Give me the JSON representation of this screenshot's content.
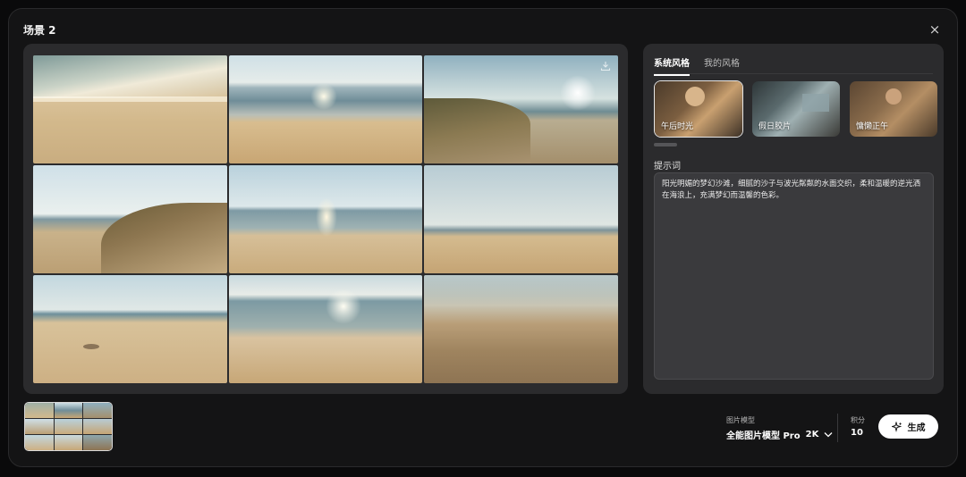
{
  "modal": {
    "title": "场景 2",
    "close_icon": "×"
  },
  "style_tabs": [
    {
      "label": "系统风格",
      "active": true
    },
    {
      "label": "我的风格",
      "active": false
    }
  ],
  "styles": [
    {
      "label": "午后时光",
      "selected": true
    },
    {
      "label": "假日胶片",
      "selected": false
    },
    {
      "label": "慵懒正午",
      "selected": false
    }
  ],
  "prompt": {
    "label": "提示词",
    "value": "阳光明媚的梦幻沙滩，细腻的沙子与波光粼粼的水面交织，柔和温暖的逆光洒在海浪上，充满梦幻而温馨的色彩。"
  },
  "model": {
    "caption": "图片模型",
    "name": "全能图片模型 Pro",
    "resolution": "2K"
  },
  "credits": {
    "caption": "积分",
    "value": "10"
  },
  "generate": {
    "label": "生成"
  },
  "icons": {
    "close": "close-icon",
    "download": "download-icon",
    "chevron": "chevron-down-icon",
    "sparkle": "sparkle-icon"
  }
}
